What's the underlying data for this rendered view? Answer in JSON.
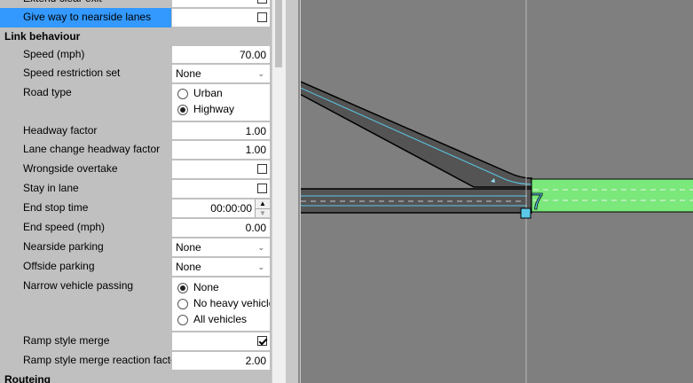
{
  "panel": {
    "top_row": {
      "label": "Extend clear exit",
      "checked": false
    },
    "give_way": {
      "label": "Give way to nearside lanes",
      "checked": false
    },
    "categories": {
      "link_behaviour": "Link behaviour",
      "routeing": "Routeing"
    },
    "speed": {
      "label": "Speed (mph)",
      "value": "70.00"
    },
    "speed_restriction": {
      "label": "Speed restriction set",
      "value": "None"
    },
    "road_type": {
      "label": "Road type",
      "options": [
        "Urban",
        "Highway"
      ],
      "selected": "Highway"
    },
    "headway": {
      "label": "Headway factor",
      "value": "1.00"
    },
    "lane_change_headway": {
      "label": "Lane change headway factor",
      "value": "1.00"
    },
    "wrongside": {
      "label": "Wrongside overtake",
      "checked": false
    },
    "stay_in_lane": {
      "label": "Stay in lane",
      "checked": false
    },
    "end_stop_time": {
      "label": "End stop time",
      "value": "00:00:00"
    },
    "end_speed": {
      "label": "End speed (mph)",
      "value": "0.00"
    },
    "nearside_parking": {
      "label": "Nearside parking",
      "value": "None"
    },
    "offside_parking": {
      "label": "Offside parking",
      "value": "None"
    },
    "narrow_vehicle": {
      "label": "Narrow vehicle passing",
      "options": [
        "None",
        "No heavy vehicle",
        "All vehicles"
      ],
      "selected": "None"
    },
    "ramp_merge": {
      "label": "Ramp style merge",
      "checked": true
    },
    "ramp_reaction": {
      "label": "Ramp style merge reaction factor",
      "value": "2.00"
    }
  },
  "canvas": {
    "node_label": "7",
    "colors": {
      "road": "#545454",
      "link_line": "#5bc8e8",
      "green_link": "#7ae87a",
      "node": "#5bc8e8",
      "highlight": "#3399ff"
    }
  }
}
